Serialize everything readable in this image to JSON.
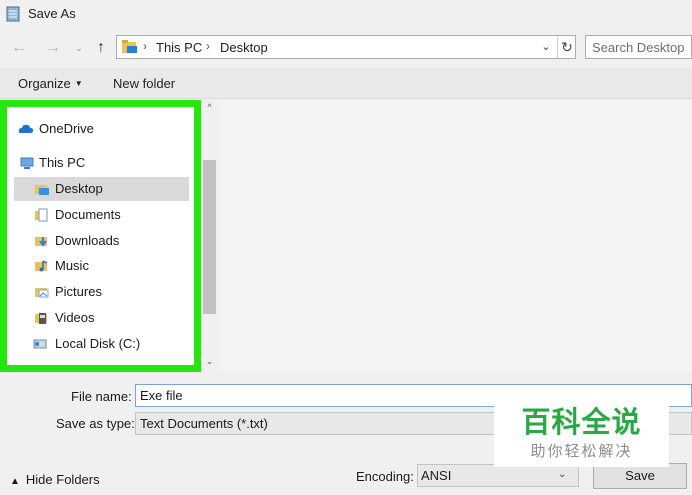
{
  "window": {
    "title": "Save As"
  },
  "nav": {
    "back": "←",
    "forward": "→",
    "up": "↑"
  },
  "address": {
    "crumbs": [
      "This PC",
      "Desktop"
    ],
    "separator": "›",
    "dropdown": "⌄",
    "refresh": "↻"
  },
  "search": {
    "placeholder": "Search Desktop"
  },
  "toolbar": {
    "organize": "Organize",
    "new_folder": "New folder"
  },
  "tree": {
    "items": [
      {
        "label": "OneDrive",
        "icon": "cloud-icon",
        "color": "#1e73d2"
      },
      {
        "label": "This PC",
        "icon": "computer-icon",
        "color": "#3a7cc7"
      },
      {
        "label": "Desktop",
        "icon": "desktop-folder-icon",
        "color": "#3a8ee6",
        "selected": true
      },
      {
        "label": "Documents",
        "icon": "documents-folder-icon",
        "color": "#7b9ac4"
      },
      {
        "label": "Downloads",
        "icon": "downloads-folder-icon",
        "color": "#2d7fd6"
      },
      {
        "label": "Music",
        "icon": "music-folder-icon",
        "color": "#e0b43a"
      },
      {
        "label": "Pictures",
        "icon": "pictures-folder-icon",
        "color": "#7aa7d9"
      },
      {
        "label": "Videos",
        "icon": "videos-folder-icon",
        "color": "#555555"
      },
      {
        "label": "Local Disk (C:)",
        "icon": "disk-icon",
        "color": "#7aa7d9"
      }
    ]
  },
  "fields": {
    "file_name_label": "File name:",
    "file_name_value": "Exe file",
    "save_type_label": "Save as type:",
    "save_type_value": "Text Documents (*.txt)"
  },
  "footer": {
    "hide_folders": "Hide Folders",
    "encoding_label": "Encoding:",
    "encoding_value": "ANSI",
    "save": "Save"
  },
  "watermark": {
    "main": "百科全说",
    "sub": "助你轻松解决"
  },
  "colors": {
    "highlight_border": "#25e60f",
    "watermark_green": "#2aa845"
  }
}
